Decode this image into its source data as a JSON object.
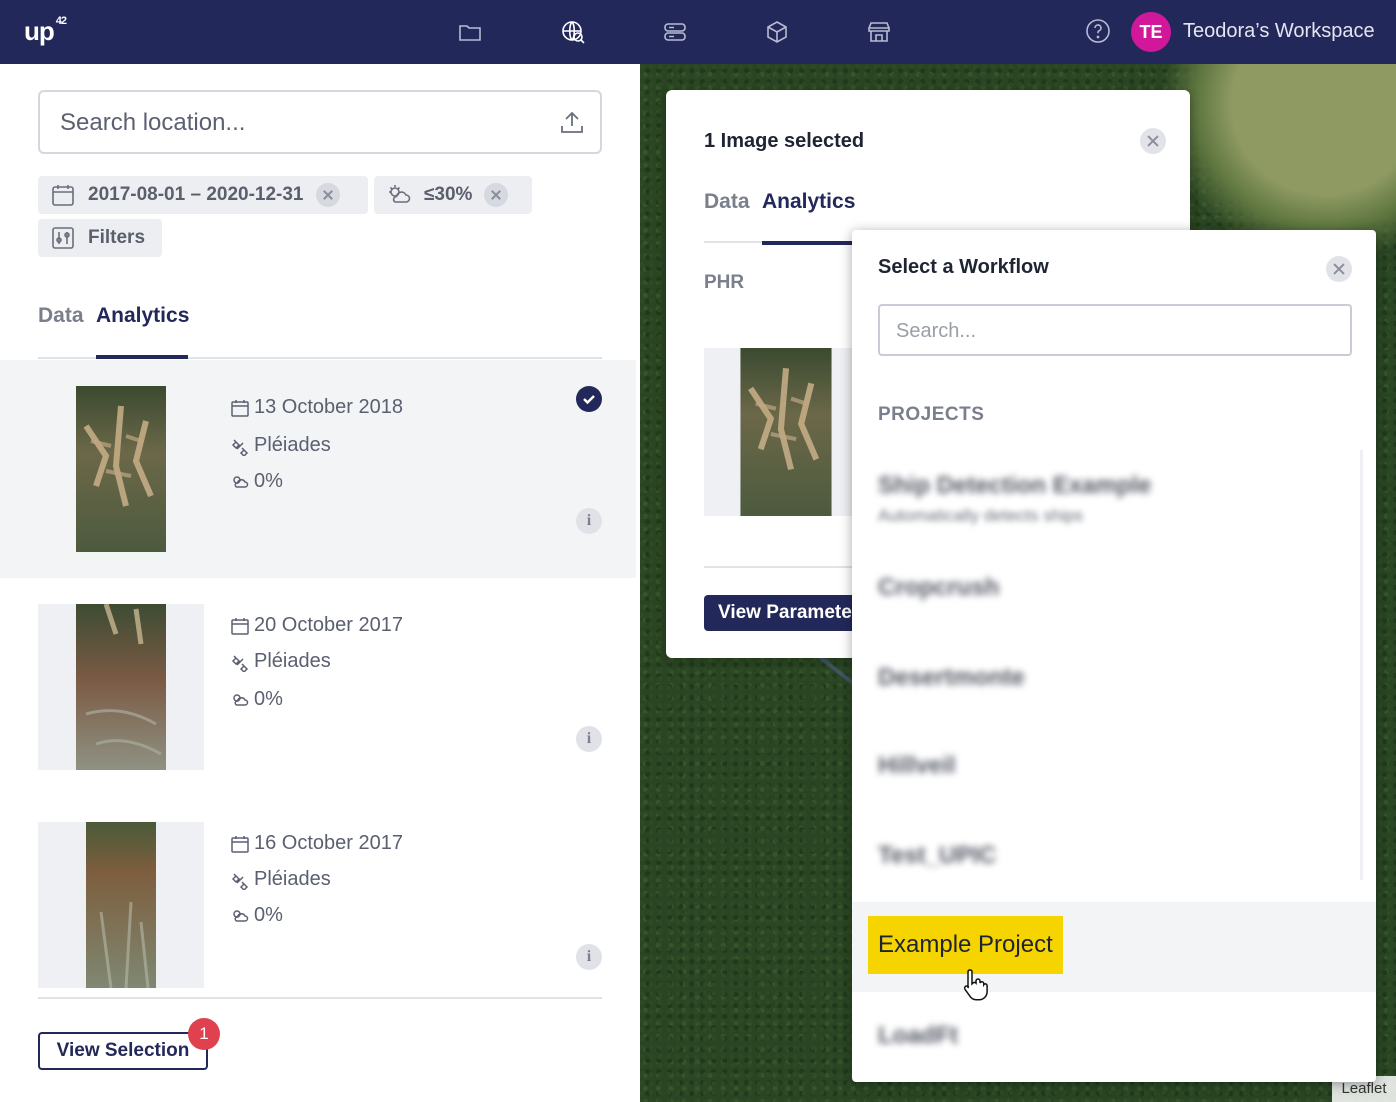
{
  "header": {
    "logo": "up",
    "logo_sup": "42",
    "avatar_initials": "TE",
    "workspace_name": "Teodora’s Workspace",
    "nav_icons": [
      "folder-icon",
      "globe-search-icon",
      "storage-icon",
      "cube-icon",
      "storefront-icon"
    ],
    "help_icon": "help-circle-icon",
    "colors": {
      "bar": "#23285a",
      "avatar": "#d1189a"
    }
  },
  "search": {
    "placeholder": "Search location...",
    "upload_icon": "upload-icon"
  },
  "filters": {
    "date_range": "2017-08-01 – 2020-12-31",
    "cloud": "≤30%",
    "filters_label": "Filters"
  },
  "left_tabs": [
    "Data",
    "Analytics"
  ],
  "left_active_tab": "Analytics",
  "results": [
    {
      "date": "13 October 2018",
      "sensor": "Pléiades",
      "cloud": "0%",
      "selected": true
    },
    {
      "date": "20 October 2017",
      "sensor": "Pléiades",
      "cloud": "0%",
      "selected": false
    },
    {
      "date": "16 October 2017",
      "sensor": "Pléiades",
      "cloud": "0%",
      "selected": false
    }
  ],
  "view_selection": {
    "label": "View Selection",
    "count": "1",
    "badge_color": "#e0414f"
  },
  "selection_panel": {
    "title": "1 Image selected",
    "tabs": [
      "Data",
      "Analytics"
    ],
    "active_tab": "Analytics",
    "collection": "PHR",
    "view_params_label": "View Parameters"
  },
  "workflow_dropdown": {
    "title": "Select a Workflow",
    "search_placeholder": "Search...",
    "section_label": "PROJECTS",
    "blurred_items": [
      {
        "name": "Ship Detection Example",
        "sub": "Automatically detects ships"
      },
      {
        "name": "Cropcrush"
      },
      {
        "name": "Desertmonte"
      },
      {
        "name": "Hillveil"
      },
      {
        "name": "Test_UPIC"
      }
    ],
    "highlighted_item": "Example Project",
    "highlight_color": "#f5d400",
    "last_item": "LoadFt"
  },
  "map": {
    "attribution": "Leaflet"
  }
}
